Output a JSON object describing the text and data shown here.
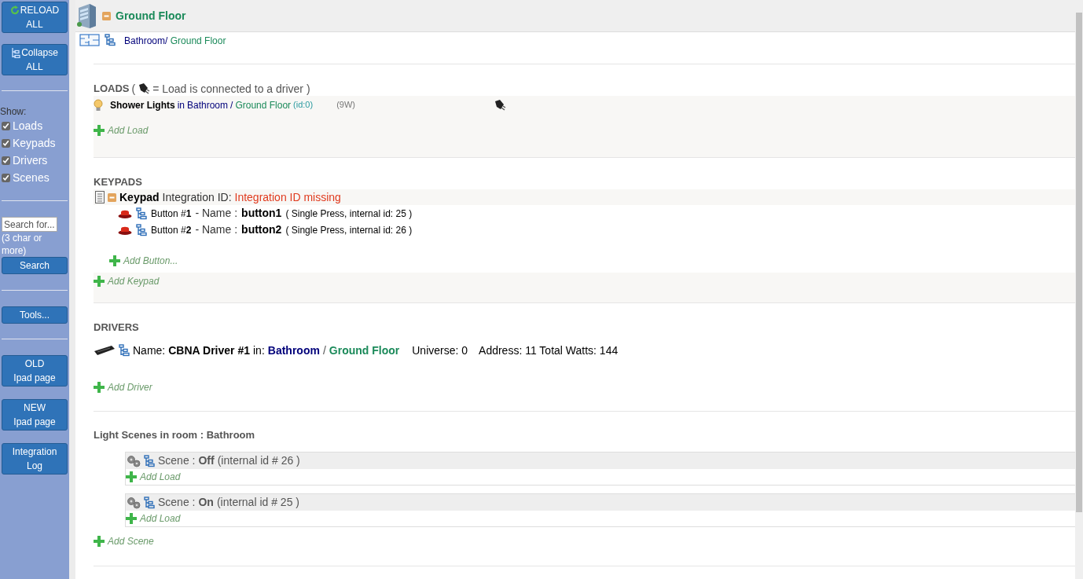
{
  "sidebar": {
    "reload_button": [
      "RELOAD",
      "ALL"
    ],
    "collapse_button": [
      "Collapse",
      "ALL"
    ],
    "show_label": "Show:",
    "filters": [
      {
        "label": "Loads",
        "checked": true
      },
      {
        "label": "Keypads",
        "checked": true
      },
      {
        "label": "Drivers",
        "checked": true
      },
      {
        "label": "Scenes",
        "checked": true
      }
    ],
    "search": {
      "placeholder": "Search for...",
      "hint": "(3 char or more)",
      "button": "Search"
    },
    "tools_button": "Tools...",
    "link_buttons": [
      [
        "OLD",
        "Ipad page"
      ],
      [
        "NEW",
        "Ipad page"
      ],
      [
        "Integration",
        "Log"
      ]
    ]
  },
  "header": {
    "title": "Ground Floor",
    "expanded": true
  },
  "breadcrumb": {
    "room": "Bathroom/",
    "floor": "Ground Floor"
  },
  "loads": {
    "heading": "LOADS",
    "legend_open": "(",
    "legend_text": "= Load is connected to a driver )",
    "items": [
      {
        "name": "Shower Lights",
        "in": "in",
        "room": "Bathroom",
        "sep": "/",
        "floor": "Ground Floor",
        "id": "(id:0)",
        "watts": "(9W)",
        "connected": true
      }
    ],
    "add": "Add Load"
  },
  "keypads": {
    "heading": "KEYPADS",
    "items": [
      {
        "label": "Keypad",
        "id_label": "Integration ID:",
        "id_value": "Integration ID missing",
        "expanded": true,
        "buttons": [
          {
            "label": "Button #**1**",
            "name_label": "- Name :",
            "name": "button1",
            "detail": "( Single Press, internal id: 25 )"
          },
          {
            "label": "Button #**2**",
            "name_label": "- Name :",
            "name": "button2",
            "detail": "( Single Press, internal id: 26 )"
          }
        ],
        "add": "Add Button..."
      }
    ],
    "add": "Add Keypad"
  },
  "drivers": {
    "heading": "DRIVERS",
    "items": [
      {
        "name_label": "Name:",
        "name": "CBNA Driver #1",
        "in": "in:",
        "room": "Bathroom",
        "sep": "/",
        "floor": "Ground Floor",
        "universe": "Universe: 0",
        "address": "Address: 11 Total Watts: 144"
      }
    ],
    "add": "Add Driver"
  },
  "scenes": {
    "heading": "Light Scenes in room : Bathroom",
    "items": [
      {
        "label": "Scene :",
        "name": "Off",
        "detail": "(internal id # 26 )",
        "add": "Add Load"
      },
      {
        "label": "Scene :",
        "name": "On",
        "detail": "(internal id # 25 )",
        "add": "Add Load"
      }
    ],
    "add": "Add Scene"
  }
}
